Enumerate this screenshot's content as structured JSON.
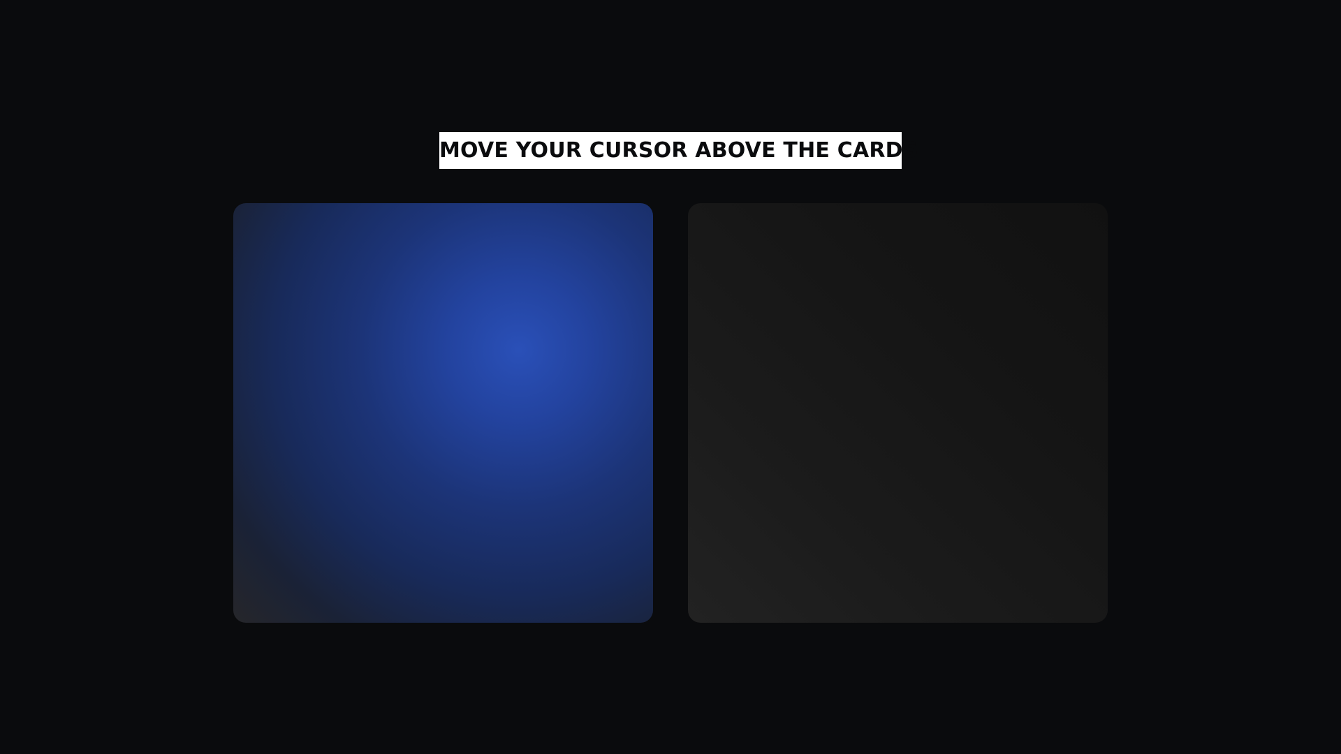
{
  "page": {
    "heading": "MOVE YOUR CURSOR ABOVE THE CARDS"
  },
  "cards": [
    {
      "name": "left",
      "state": "hovered",
      "glow_color": "#2a50b8"
    },
    {
      "name": "right",
      "state": "idle",
      "base_color": "#1b1b1b"
    }
  ],
  "colors": {
    "background": "#0a0b0d",
    "heading_background": "#ffffff",
    "heading_text": "#0a0b0d"
  }
}
